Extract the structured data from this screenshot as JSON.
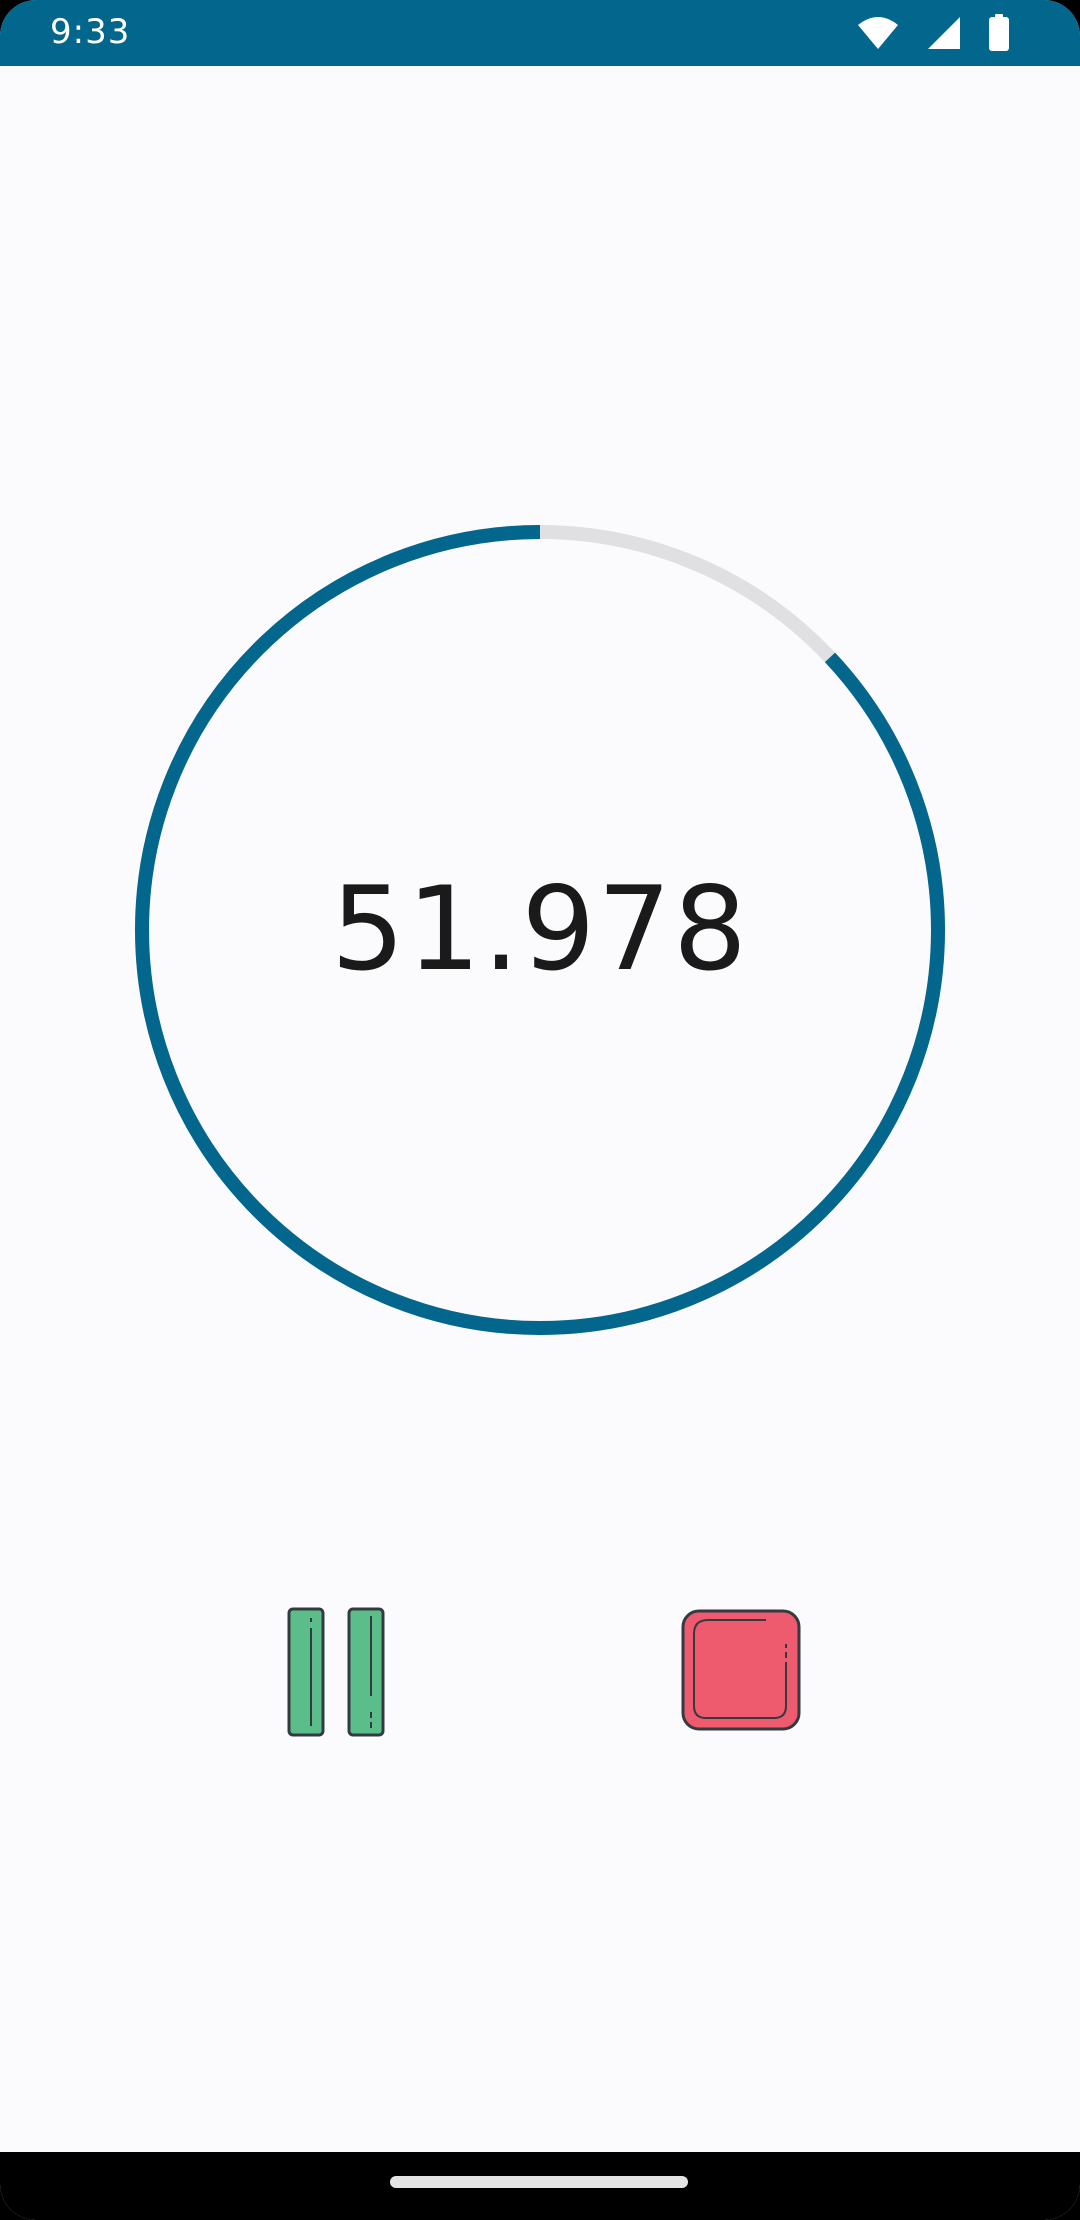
{
  "status_bar": {
    "time": "9:33",
    "background": "#03668c",
    "icons": [
      "wifi-icon",
      "signal-icon",
      "battery-icon"
    ]
  },
  "timer": {
    "display": "51.978",
    "progress_fraction": 0.87,
    "ring_color": "#03668c",
    "track_color": "#e0e0e2"
  },
  "controls": {
    "pause_icon": "pause-icon",
    "pause_color": "#5bbd8a",
    "stop_icon": "stop-icon",
    "stop_color": "#ef5b6e"
  },
  "nav_bar": {
    "handle": "home-handle"
  }
}
